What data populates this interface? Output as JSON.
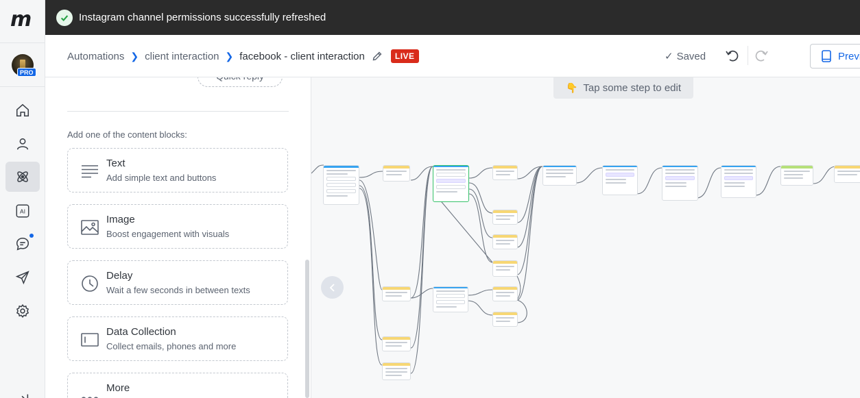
{
  "banner": {
    "message": "Instagram channel permissions successfully refreshed"
  },
  "sidebar": {
    "avatar_badge": "PRO",
    "items": [
      {
        "icon": "home-icon"
      },
      {
        "icon": "user-icon"
      },
      {
        "icon": "automation-icon",
        "active": true
      },
      {
        "icon": "ai-icon",
        "label": "AI"
      },
      {
        "icon": "chat-icon",
        "has_notification": true
      },
      {
        "icon": "send-icon"
      },
      {
        "icon": "gear-icon"
      },
      {
        "icon": "collapse-sidebar-icon"
      }
    ]
  },
  "header": {
    "breadcrumbs": [
      "Automations",
      "client interaction",
      "facebook - client interaction"
    ],
    "status_badge": "LIVE",
    "saved_label": "Saved",
    "preview_label": "Preview"
  },
  "panel": {
    "quick_reply_label": "Quick reply",
    "caption": "Add one of the content blocks:",
    "blocks": [
      {
        "title": "Text",
        "description": "Add simple text and buttons",
        "icon": "text-lines-icon"
      },
      {
        "title": "Image",
        "description": "Boost engagement with visuals",
        "icon": "image-icon"
      },
      {
        "title": "Delay",
        "description": "Wait a few seconds in between texts",
        "icon": "clock-icon"
      },
      {
        "title": "Data Collection",
        "description": "Collect emails, phones and more",
        "icon": "input-field-icon"
      },
      {
        "title": "More",
        "description": "",
        "icon": "more-dots-icon"
      }
    ]
  },
  "canvas": {
    "hint_text": "Tap some step to edit",
    "colors": {
      "yellow": "#f7d774",
      "green": "#b6e07a",
      "blue": "#36a3f0",
      "selected": "#36c26a"
    }
  }
}
